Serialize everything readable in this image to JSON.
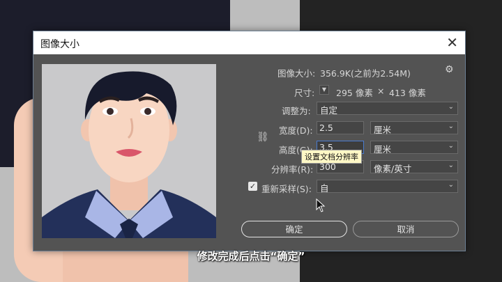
{
  "dialog": {
    "title": "图像大小",
    "image_size_label": "图像大小:",
    "image_size_value": "356.9K(之前为2.54M)",
    "dimensions_label": "尺寸:",
    "dimensions_width": "295 像素",
    "dimensions_sep": "×",
    "dimensions_height": "413 像素",
    "fit_to_label": "调整为:",
    "fit_to_value": "自定",
    "width_label": "宽度(D):",
    "width_value": "2.5",
    "width_unit": "厘米",
    "height_label": "高度(G):",
    "height_value": "3.5",
    "height_unit": "厘米",
    "resolution_label": "分辨率(R):",
    "resolution_value": "300",
    "resolution_unit": "像素/英寸",
    "resample_label": "重新采样(S):",
    "resample_value": "自",
    "tooltip": "设置文档分辨率",
    "ok_label": "确定",
    "cancel_label": "取消"
  },
  "subtitle": "修改完成后点击“确定”",
  "colors": {
    "dialog_bg": "#535353",
    "input_bg": "#454545",
    "focus_border": "#4a7bd0",
    "tooltip_bg": "#fff8c6"
  },
  "icons": [
    "close-icon",
    "gear-icon",
    "chevron-down-icon",
    "link-icon",
    "checkbox-checked-icon",
    "mouse-cursor-icon"
  ]
}
